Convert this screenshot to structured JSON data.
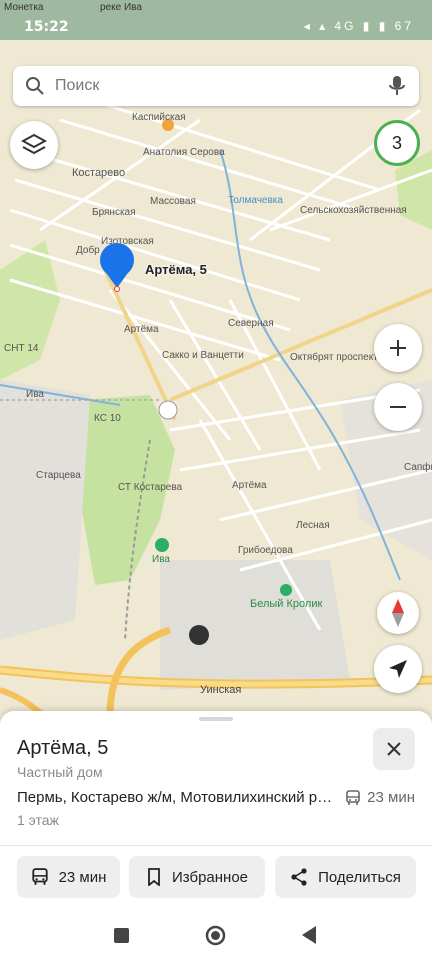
{
  "status": {
    "time": "15:22",
    "top_left": "Монетка",
    "icons": "◂ ▴ 4G ▮ ▮ 67"
  },
  "search": {
    "placeholder": "Поиск"
  },
  "map": {
    "counter": "3",
    "pin_label": "Артёма, 5",
    "labels": {
      "kostarevo": "Костарево",
      "kaspiyskaya": "Каспийская",
      "anatoliya": "Анатолия Серова",
      "bryanskaya": "Брянская",
      "masovoy": "Массовая",
      "izotovskaya": "Изотовская",
      "dobrynina": "Добр",
      "artema_top": "Артёма",
      "sakko": "Сакко и Ванцетти",
      "severnaya": "Северная",
      "oktyabr": "Октябрят проспект",
      "snt14": "СНТ 14",
      "iva_left": "Ива",
      "kc10": "КС 10",
      "startseva": "Старцева",
      "st_kostareva": "СТ Костарева",
      "artema_mid": "Артёма",
      "lesnaya": "Лесная",
      "griboedova": "Грибоедова",
      "iva_stop": "Ива",
      "beliy_krolik": "Белый Кролик",
      "uinskaya": "Уинская",
      "tolmachevka": "Толмачевка",
      "selkhoz": "Сельскохозяйственная",
      "sapfir": "Сапфир",
      "reka_iva": "реке Ива"
    }
  },
  "sheet": {
    "title": "Артёма, 5",
    "subtitle": "Частный дом",
    "address": "Пермь, Костарево ж/м, Мотовилихинский район",
    "transit_time": "23 мин",
    "floors": "1 этаж",
    "buttons": {
      "route": "23 мин",
      "favorite": "Избранное",
      "share": "Поделиться"
    }
  },
  "colors": {
    "map_bg": "#efe8d2",
    "green_area": "#cfe6a8",
    "road_orange": "#f3c25a",
    "river": "#7fb3d9",
    "pin_blue": "#1a73e8",
    "counter_border": "#4caf50"
  }
}
